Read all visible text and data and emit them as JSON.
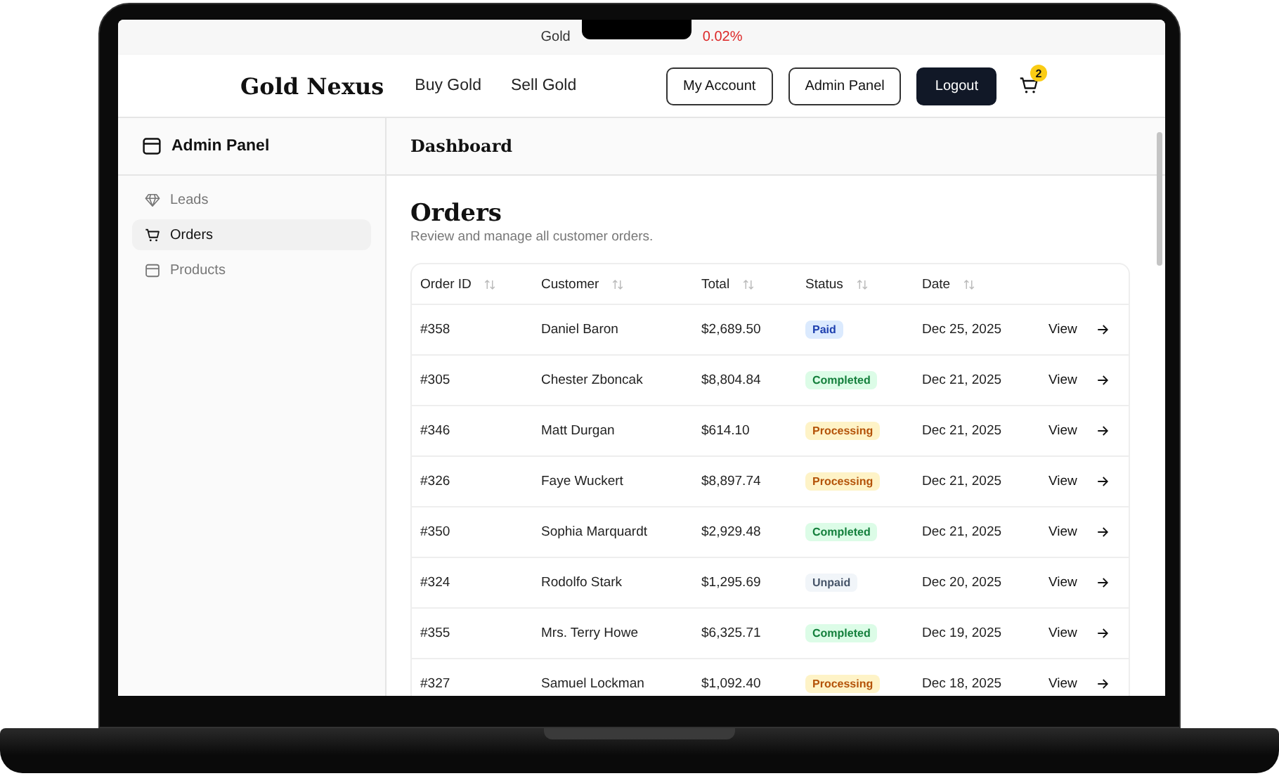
{
  "ticker": {
    "label": "Gold",
    "change": "0.02%"
  },
  "header": {
    "brand": "Gold Nexus",
    "nav": [
      "Buy Gold",
      "Sell Gold"
    ],
    "buttons": [
      {
        "label": "My Account",
        "kind": "outline"
      },
      {
        "label": "Admin Panel",
        "kind": "outline"
      },
      {
        "label": "Logout",
        "kind": "solid"
      }
    ],
    "cart_count": "2"
  },
  "sidebar": {
    "title": "Admin Panel",
    "items": [
      {
        "label": "Leads",
        "kind": "gem",
        "selected": false
      },
      {
        "label": "Orders",
        "kind": "cart",
        "selected": true
      },
      {
        "label": "Products",
        "kind": "box",
        "selected": false
      }
    ]
  },
  "page": {
    "breadcrumb": "Dashboard",
    "title": "Orders",
    "subtitle": "Review and manage all customer orders."
  },
  "table": {
    "columns": [
      "Order ID",
      "Customer",
      "Total",
      "Status",
      "Date"
    ],
    "rows": [
      {
        "id": "#358",
        "customer": "Daniel Baron",
        "total": "$2,689.50",
        "status": {
          "label": "Paid",
          "kind": "paid"
        },
        "date": "Dec 25, 2025",
        "action": "View"
      },
      {
        "id": "#305",
        "customer": "Chester Zboncak",
        "total": "$8,804.84",
        "status": {
          "label": "Completed",
          "kind": "completed"
        },
        "date": "Dec 21, 2025",
        "action": "View"
      },
      {
        "id": "#346",
        "customer": "Matt Durgan",
        "total": "$614.10",
        "status": {
          "label": "Processing",
          "kind": "processing"
        },
        "date": "Dec 21, 2025",
        "action": "View"
      },
      {
        "id": "#326",
        "customer": "Faye Wuckert",
        "total": "$8,897.74",
        "status": {
          "label": "Processing",
          "kind": "processing"
        },
        "date": "Dec 21, 2025",
        "action": "View"
      },
      {
        "id": "#350",
        "customer": "Sophia Marquardt",
        "total": "$2,929.48",
        "status": {
          "label": "Completed",
          "kind": "completed"
        },
        "date": "Dec 21, 2025",
        "action": "View"
      },
      {
        "id": "#324",
        "customer": "Rodolfo Stark",
        "total": "$1,295.69",
        "status": {
          "label": "Unpaid",
          "kind": "unpaid"
        },
        "date": "Dec 20, 2025",
        "action": "View"
      },
      {
        "id": "#355",
        "customer": "Mrs. Terry Howe",
        "total": "$6,325.71",
        "status": {
          "label": "Completed",
          "kind": "completed"
        },
        "date": "Dec 19, 2025",
        "action": "View"
      },
      {
        "id": "#327",
        "customer": "Samuel Lockman",
        "total": "$1,092.40",
        "status": {
          "label": "Processing",
          "kind": "processing"
        },
        "date": "Dec 18, 2025",
        "action": "View"
      }
    ]
  }
}
